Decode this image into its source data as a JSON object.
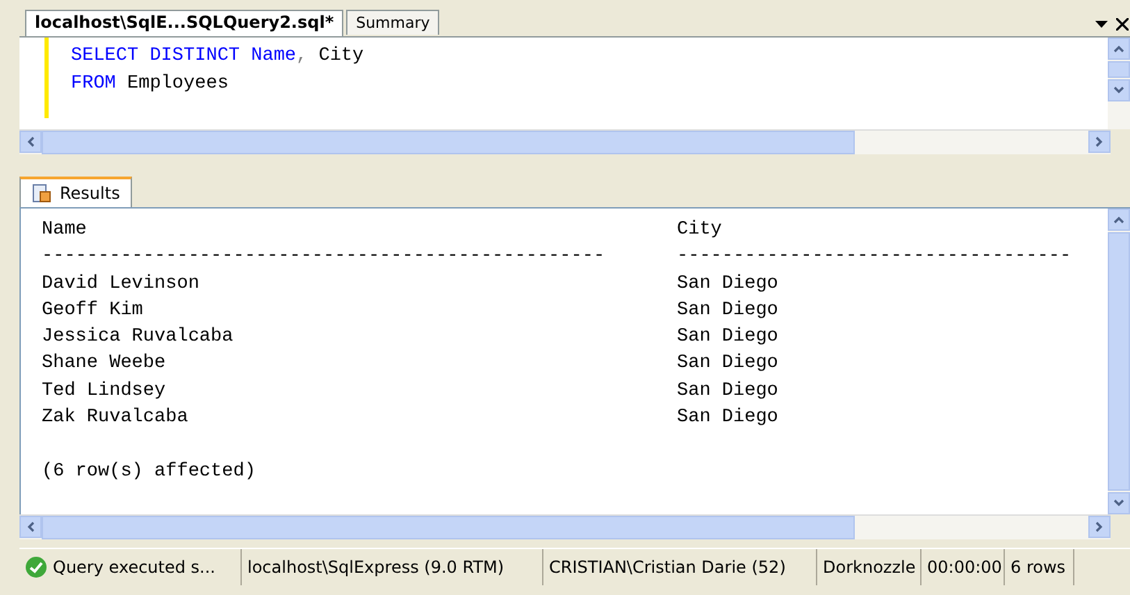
{
  "document_tabs": [
    {
      "label": "localhost\\SqlE...SQLQuery2.sql*",
      "selected": true
    },
    {
      "label": "Summary",
      "selected": false
    }
  ],
  "editor": {
    "lines": [
      [
        {
          "text": "SELECT DISTINCT Name",
          "kind": "keyword"
        },
        {
          "text": ", ",
          "kind": "punct"
        },
        {
          "text": "City",
          "kind": "plain"
        }
      ],
      [
        {
          "text": "FROM",
          "kind": "keyword"
        },
        {
          "text": " Employees",
          "kind": "plain"
        }
      ]
    ]
  },
  "results_tabs": [
    {
      "label": "Results",
      "selected": true
    }
  ],
  "results": {
    "columns": [
      "Name",
      "City"
    ],
    "separators": [
      "--------------------------------------------------",
      "-----------------------------------"
    ],
    "rows": [
      [
        "David Levinson",
        "San Diego"
      ],
      [
        "Geoff Kim",
        "San Diego"
      ],
      [
        "Jessica Ruvalcaba",
        "San Diego"
      ],
      [
        "Shane Weebe",
        "San Diego"
      ],
      [
        "Ted Lindsey",
        "San Diego"
      ],
      [
        "Zak Ruvalcaba",
        "San Diego"
      ]
    ],
    "message": "(6 row(s) affected)"
  },
  "status_bar": [
    "Query executed s...",
    "localhost\\SqlExpress (9.0 RTM)",
    "CRISTIAN\\Cristian Darie (52)",
    "Dorknozzle",
    "00:00:00",
    "6 rows"
  ]
}
